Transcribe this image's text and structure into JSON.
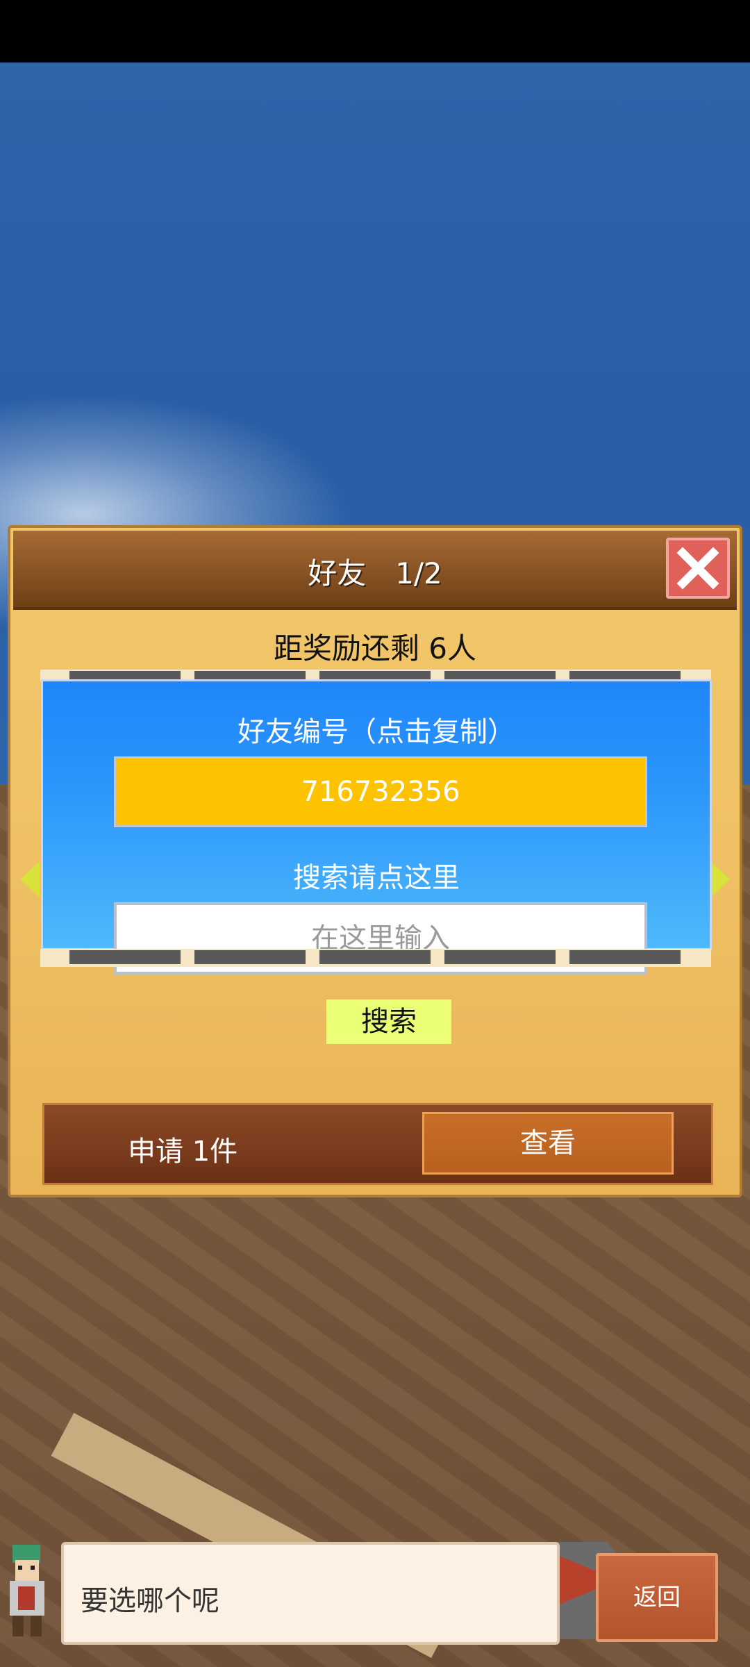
{
  "dialog": {
    "title": "好友　1/2",
    "reward_text": "距奖励还剩 6人",
    "panel": {
      "friend_id_label": "好友编号（点击复制）",
      "friend_id": "716732356",
      "search_label": "搜索请点这里",
      "search_placeholder": "在这里输入",
      "search_button": "搜索"
    },
    "apply": {
      "text": "申请 1件",
      "view_button": "查看"
    }
  },
  "bottom": {
    "message": "要选哪个呢",
    "back_button": "返回"
  },
  "icons": {
    "close": "close-icon",
    "prev": "left-arrow-icon",
    "next": "right-arrow-icon"
  }
}
